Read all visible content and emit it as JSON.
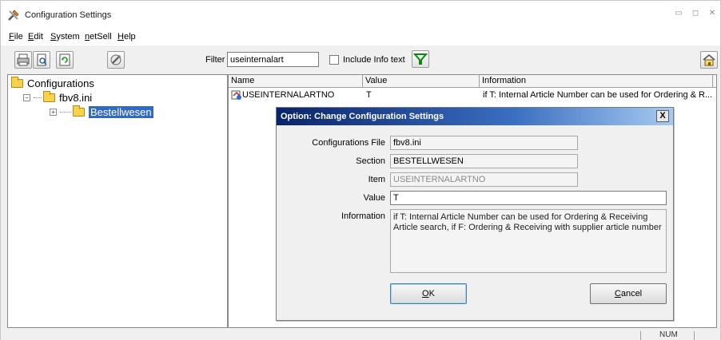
{
  "window": {
    "title": "Configuration Settings"
  },
  "menu": {
    "items": [
      {
        "label": "File",
        "accel": "F",
        "rest": "ile"
      },
      {
        "label": "Edit",
        "accel": "E",
        "rest": "dit"
      },
      {
        "label": "System",
        "accel": "S",
        "rest": "ystem"
      },
      {
        "label": "netSell",
        "accel": "n",
        "rest": "etSell"
      },
      {
        "label": "Help",
        "accel": "H",
        "rest": "elp"
      }
    ]
  },
  "toolbar": {
    "filter_label": "Filter",
    "filter_value": "useinternalart",
    "include_info_label": "Include Info text",
    "include_info_checked": false
  },
  "tree": {
    "root": "Configurations",
    "file": "fbv8.ini",
    "section": "Bestellwesen"
  },
  "list": {
    "columns": [
      "Name",
      "Value",
      "Information"
    ],
    "rows": [
      {
        "name": "USEINTERNALARTNO",
        "value": "T",
        "info": "if T: Internal Article Number can be used for Ordering & R..."
      }
    ]
  },
  "dialog": {
    "title": "Option: Change Configuration Settings",
    "close_label": "X",
    "labels": {
      "file": "Configurations File",
      "section": "Section",
      "item": "Item",
      "value": "Value",
      "information": "Information"
    },
    "fields": {
      "file": "fbv8.ini",
      "section": "BESTELLWESEN",
      "item": "USEINTERNALARTNO",
      "value": "T",
      "information": "if T: Internal Article Number can be used for Ordering & Receiving Article search, if F: Ordering & Receiving with supplier article number"
    },
    "ok_label": "OK",
    "ok_accel": "O",
    "ok_rest": "K",
    "cancel_label": "Cancel",
    "cancel_accel": "C",
    "cancel_rest": "ancel"
  },
  "statusbar": {
    "num": "NUM"
  },
  "colors": {
    "selection": "#316ac5",
    "dialog_title_start": "#0a246a",
    "filter_icon": "#00a000"
  }
}
